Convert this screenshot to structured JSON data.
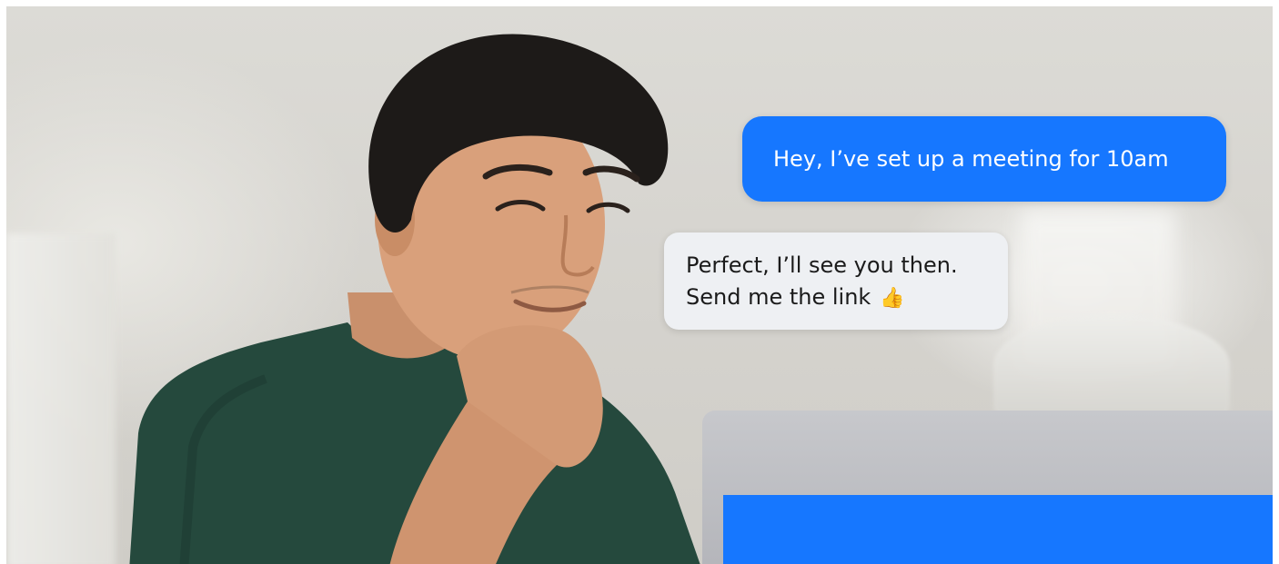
{
  "chat": {
    "outgoing_message": "Hey, I’ve set up a meeting for 10am",
    "incoming_message_line1": "Perfect, I’ll see you then.",
    "incoming_message_line2": "Send me the link",
    "incoming_emoji": "👍"
  },
  "colors": {
    "brand_blue": "#1677ff",
    "incoming_bubble": "#eef0f3",
    "shirt_green": "#25493d"
  },
  "icons": {
    "emoji": "thumbs-up-icon"
  }
}
